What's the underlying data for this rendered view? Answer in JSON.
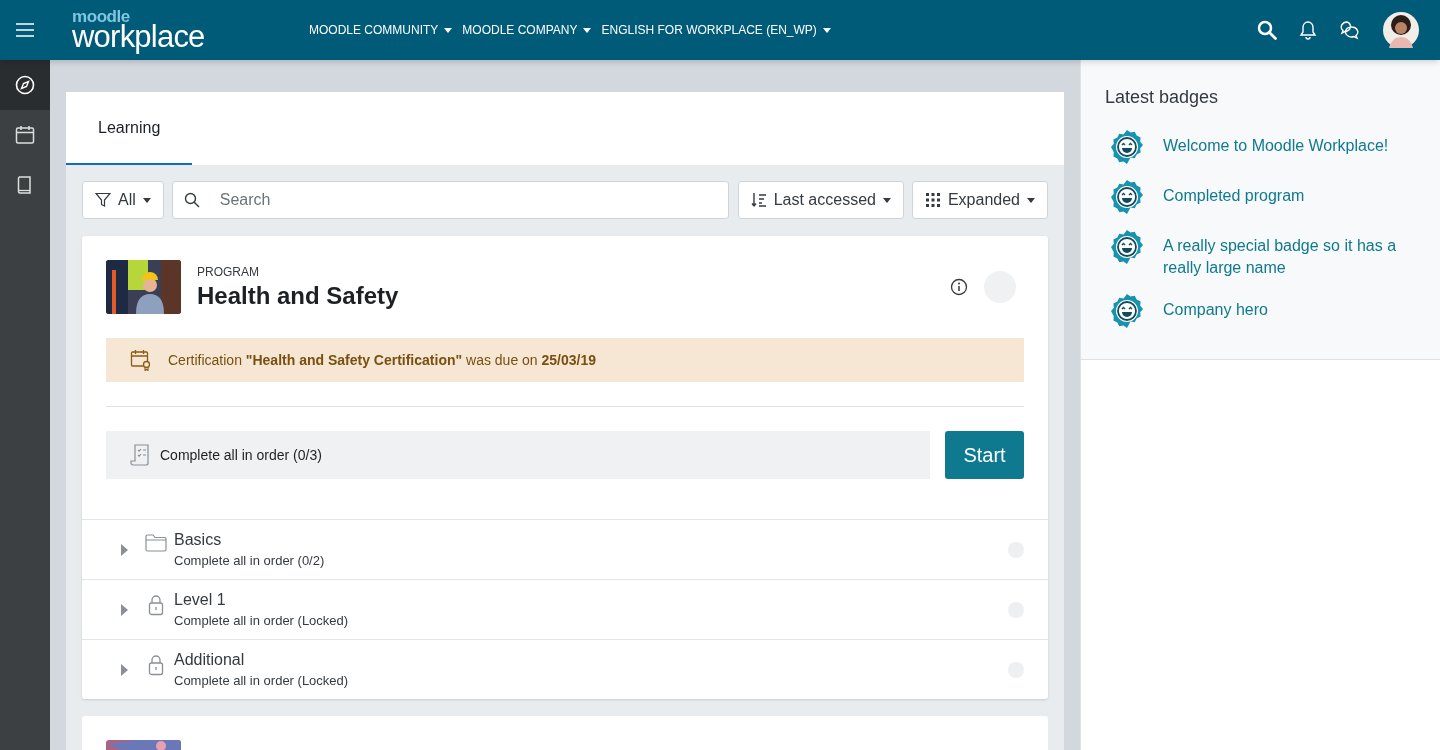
{
  "header": {
    "logo_top": "moodle",
    "logo_main": "workplace",
    "menus": [
      "MOODLE COMMUNITY",
      "MOODLE COMPANY",
      "ENGLISH FOR WORKPLACE (EN_WP)"
    ]
  },
  "rail": [
    {
      "selected": true
    },
    {
      "selected": false
    },
    {
      "selected": false
    }
  ],
  "tabs": [
    {
      "label": "Learning",
      "selected": true
    }
  ],
  "toolbar": {
    "filter": "All",
    "search_placeholder": "Search",
    "sort": "Last accessed",
    "view": "Expanded"
  },
  "program": {
    "type_label": "PROGRAM",
    "title": "Health and Safety",
    "alert": "Certification **\"Health and Safety Certification\"** was due on **25/03/19**",
    "set_label": "Complete all in order (0/3)",
    "start": "Start",
    "items": [
      {
        "kind": "folder",
        "title": "Basics",
        "subtitle": "Complete all in order (0/2)",
        "expanded": false
      },
      {
        "kind": "locked",
        "title": "Level 1",
        "subtitle": "Complete all in order (Locked)",
        "expanded": false
      },
      {
        "kind": "locked",
        "title": "Additional",
        "subtitle": "Complete all in order (Locked)",
        "expanded": false
      }
    ]
  },
  "badges": {
    "title": "Latest badges",
    "items": [
      "Welcome to Moodle Workplace!",
      "Completed program",
      "A really special badge so it has a really large name",
      "Company hero"
    ]
  }
}
